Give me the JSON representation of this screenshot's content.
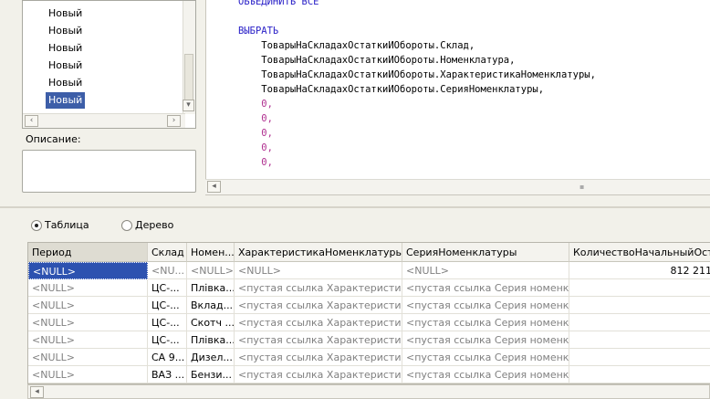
{
  "list": {
    "items": [
      "Новый",
      "Новый",
      "Новый",
      "Новый",
      "Новый",
      "Новый"
    ],
    "selected_index": 5
  },
  "description": {
    "label": "Описание:"
  },
  "editor": {
    "lines": [
      {
        "cls": "kw",
        "text": "ОБЪЕДИНИТЬ ВСЕ"
      },
      {
        "cls": "kw",
        "text": "ВЫБРАТЬ"
      },
      {
        "cls": "id",
        "text": "    ТоварыНаСкладахОстаткиИОбороты.Склад,"
      },
      {
        "cls": "id",
        "text": "    ТоварыНаСкладахОстаткиИОбороты.Номенклатура,"
      },
      {
        "cls": "id",
        "text": "    ТоварыНаСкладахОстаткиИОбороты.ХарактеристикаНоменклатуры,"
      },
      {
        "cls": "id",
        "text": "    ТоварыНаСкладахОстаткиИОбороты.СерияНоменклатуры,"
      },
      {
        "cls": "num",
        "text": "    0,"
      },
      {
        "cls": "num",
        "text": "    0,"
      },
      {
        "cls": "num",
        "text": "    0,"
      },
      {
        "cls": "num",
        "text": "    0,"
      },
      {
        "cls": "num",
        "text": "    0,"
      }
    ]
  },
  "view_mode": {
    "table_label": "Таблица",
    "tree_label": "Дерево",
    "selected": "table"
  },
  "table": {
    "columns": [
      "Период",
      "Склад",
      "Номен...",
      "ХарактеристикаНоменклатуры",
      "СерияНоменклатуры",
      "КоличествоНачальныйОстато"
    ],
    "rows": [
      [
        "<NULL>",
        "<NU...",
        "<NULL>",
        "<NULL>",
        "<NULL>",
        "812 211"
      ],
      [
        "<NULL>",
        "ЦС-...",
        "Плівка...",
        "<пустая ссылка Характеристик...",
        "<пустая ссылка Серия номенкл...",
        ""
      ],
      [
        "<NULL>",
        "ЦС-...",
        "Вклад...",
        "<пустая ссылка Характеристик...",
        "<пустая ссылка Серия номенкл...",
        ""
      ],
      [
        "<NULL>",
        "ЦС-...",
        "Скотч ...",
        "<пустая ссылка Характеристик...",
        "<пустая ссылка Серия номенкл...",
        ""
      ],
      [
        "<NULL>",
        "ЦС-...",
        "Плівка...",
        "<пустая ссылка Характеристик...",
        "<пустая ссылка Серия номенкл...",
        ""
      ],
      [
        "<NULL>",
        "СА 9...",
        "Дизел...",
        "<пустая ссылка Характеристик...",
        "<пустая ссылка Серия номенкл...",
        ""
      ],
      [
        "<NULL>",
        "ВАЗ ...",
        "Бензи...",
        "<пустая ссылка Характеристик...",
        "<пустая ссылка Серия номенкл...",
        ""
      ]
    ]
  }
}
